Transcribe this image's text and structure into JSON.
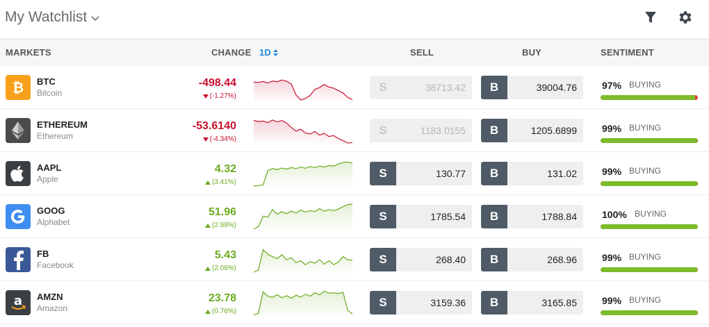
{
  "topbar": {
    "title": "My Watchlist"
  },
  "header": {
    "markets": "MARKETS",
    "change": "CHANGE",
    "period": "1D",
    "sell": "SELL",
    "buy": "BUY",
    "sentiment": "SENTIMENT"
  },
  "colors": {
    "negative": "#c8102e",
    "positive": "#6aaa1e",
    "accent": "#1e88e5",
    "buying_bar": "#7cbb2a",
    "selling_bar": "#e33b3b",
    "trade_button": "#4f5b66"
  },
  "rows": [
    {
      "symbol": "BTC",
      "name": "Bitcoin",
      "logo_icon": "bitcoin-icon",
      "logo_bg": "#f7a11a",
      "change": "-498.44",
      "change_pct": "(-1.27%)",
      "direction": "down",
      "sell_letter": "S",
      "sell_price": "38713.42",
      "sell_disabled": true,
      "buy_letter": "B",
      "buy_price": "39004.76",
      "sentiment_pct": "97%",
      "sentiment_label": "BUYING",
      "sentiment_value": 97,
      "spark": [
        0.72,
        0.7,
        0.74,
        0.68,
        0.76,
        0.73,
        0.8,
        0.75,
        0.64,
        0.2,
        0.0,
        0.06,
        0.18,
        0.42,
        0.5,
        0.62,
        0.52,
        0.47,
        0.38,
        0.28,
        0.1,
        0.02
      ]
    },
    {
      "symbol": "ETHEREUM",
      "name": "Ethereum",
      "logo_icon": "ethereum-icon",
      "logo_bg": "#4b4b4b",
      "change": "-53.6140",
      "change_pct": "(-4.34%)",
      "direction": "down",
      "sell_letter": "S",
      "sell_price": "1183.0155",
      "sell_disabled": true,
      "buy_letter": "B",
      "buy_price": "1205.6899",
      "sentiment_pct": "99%",
      "sentiment_label": "BUYING",
      "sentiment_value": 99,
      "spark": [
        0.9,
        0.86,
        0.88,
        0.82,
        0.92,
        0.85,
        0.9,
        0.8,
        0.62,
        0.48,
        0.55,
        0.4,
        0.36,
        0.46,
        0.32,
        0.38,
        0.26,
        0.3,
        0.18,
        0.1,
        0.0,
        0.02
      ]
    },
    {
      "symbol": "AAPL",
      "name": "Apple",
      "logo_icon": "apple-icon",
      "logo_bg": "#3a3f44",
      "change": "4.32",
      "change_pct": "(3.41%)",
      "direction": "up",
      "sell_letter": "S",
      "sell_price": "130.77",
      "sell_disabled": false,
      "buy_letter": "B",
      "buy_price": "131.02",
      "sentiment_pct": "99%",
      "sentiment_label": "BUYING",
      "sentiment_value": 99,
      "spark": [
        0.0,
        0.02,
        0.05,
        0.62,
        0.7,
        0.66,
        0.72,
        0.68,
        0.74,
        0.7,
        0.76,
        0.71,
        0.78,
        0.74,
        0.8,
        0.76,
        0.82,
        0.8,
        0.88,
        0.94,
        0.96,
        0.92
      ]
    },
    {
      "symbol": "GOOG",
      "name": "Alphabet",
      "logo_icon": "google-icon",
      "logo_bg": "#3d8ef0",
      "change": "51.96",
      "change_pct": "(2.99%)",
      "direction": "up",
      "sell_letter": "S",
      "sell_price": "1785.54",
      "sell_disabled": false,
      "buy_letter": "B",
      "buy_price": "1788.84",
      "sentiment_pct": "100%",
      "sentiment_label": "BUYING",
      "sentiment_value": 100,
      "spark": [
        0.0,
        0.1,
        0.52,
        0.48,
        0.78,
        0.6,
        0.7,
        0.62,
        0.72,
        0.64,
        0.76,
        0.68,
        0.74,
        0.7,
        0.82,
        0.72,
        0.78,
        0.74,
        0.8,
        0.9,
        0.98,
        1.0
      ]
    },
    {
      "symbol": "FB",
      "name": "Facebook",
      "logo_icon": "facebook-icon",
      "logo_bg": "#3b5998",
      "change": "5.43",
      "change_pct": "(2.06%)",
      "direction": "up",
      "sell_letter": "S",
      "sell_price": "268.40",
      "sell_disabled": false,
      "buy_letter": "B",
      "buy_price": "268.96",
      "sentiment_pct": "99%",
      "sentiment_label": "BUYING",
      "sentiment_value": 99,
      "spark": [
        0.0,
        0.08,
        0.9,
        0.72,
        0.62,
        0.54,
        0.7,
        0.5,
        0.58,
        0.38,
        0.46,
        0.3,
        0.42,
        0.36,
        0.5,
        0.32,
        0.46,
        0.3,
        0.4,
        0.62,
        0.5,
        0.48
      ]
    },
    {
      "symbol": "AMZN",
      "name": "Amazon",
      "logo_icon": "amazon-icon",
      "logo_bg": "#3a3f44",
      "change": "23.78",
      "change_pct": "(0.76%)",
      "direction": "up",
      "sell_letter": "S",
      "sell_price": "3159.36",
      "sell_disabled": false,
      "buy_letter": "B",
      "buy_price": "3165.85",
      "sentiment_pct": "99%",
      "sentiment_label": "BUYING",
      "sentiment_value": 99,
      "spark": [
        0.0,
        0.08,
        0.94,
        0.76,
        0.72,
        0.82,
        0.7,
        0.78,
        0.68,
        0.8,
        0.72,
        0.84,
        0.76,
        0.9,
        0.82,
        0.96,
        0.88,
        0.9,
        0.86,
        0.92,
        0.2,
        0.05
      ]
    }
  ]
}
